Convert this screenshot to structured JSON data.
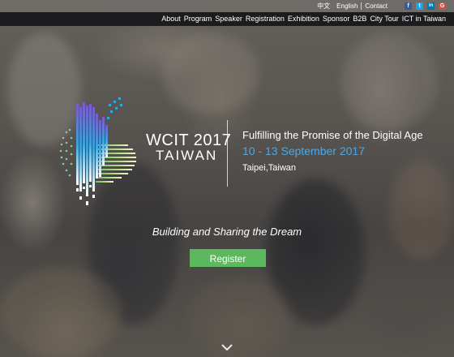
{
  "topbar": {
    "links": [
      "中文",
      "English",
      "Contact"
    ],
    "social": [
      {
        "icon": "facebook-icon",
        "glyph": "f",
        "color": "#3b5998"
      },
      {
        "icon": "twitter-icon",
        "glyph": "t",
        "color": "#1da1f2"
      },
      {
        "icon": "linkedin-icon",
        "glyph": "in",
        "color": "#0077b5"
      },
      {
        "icon": "google-plus-icon",
        "glyph": "G",
        "color": "#dd4b39"
      }
    ]
  },
  "nav": {
    "items": [
      "About",
      "Program",
      "Speaker",
      "Registration",
      "Exhibition",
      "Sponsor",
      "B2B",
      "City Tour",
      "ICT in Taiwan"
    ]
  },
  "hero": {
    "brand_line1": "WCIT 2017",
    "brand_line2": "TAIWAN",
    "tagline": "Fulfilling the Promise of the Digital Age",
    "dates": "10 - 13 September 2017",
    "location": "Taipei,Taiwan",
    "slogan": "Building and Sharing the Dream",
    "register_label": "Register",
    "colors": {
      "dates": "#4fa6e4",
      "register": "#5cb85c",
      "nav_bg": "#1c1c1e"
    }
  }
}
